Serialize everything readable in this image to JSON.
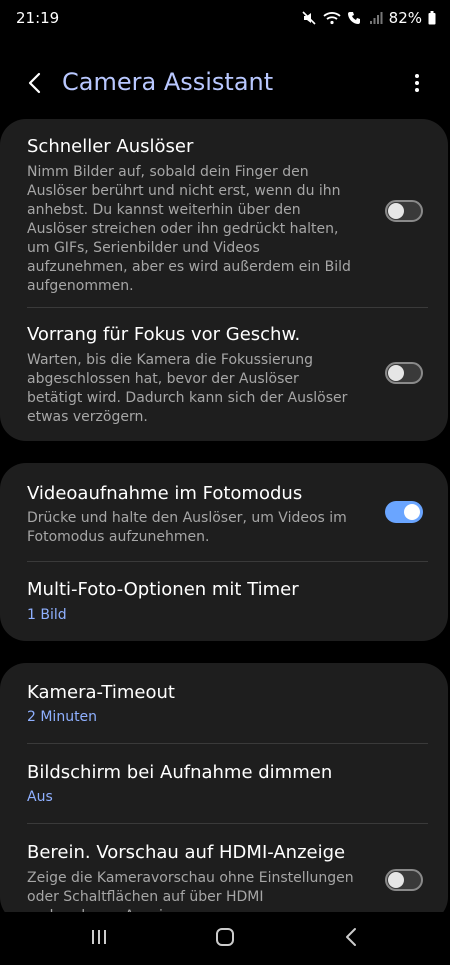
{
  "status": {
    "time": "21:19",
    "battery": "82%",
    "icons": [
      "mute-icon",
      "wifi-icon",
      "wifi-call-icon",
      "signal-icon",
      "battery-icon"
    ]
  },
  "appbar": {
    "title": "Camera Assistant",
    "back_icon": "chevron-left-icon",
    "more_icon": "more-vertical-icon"
  },
  "sections": [
    {
      "rows": [
        {
          "title": "Schneller Auslöser",
          "desc": "Nimm Bilder auf, sobald dein Finger den Auslöser berührt und nicht erst, wenn du ihn anhebst. Du kannst weiterhin über den Auslöser streichen oder ihn gedrückt halten, um GIFs, Serienbilder und Videos aufzunehmen, aber es wird außerdem ein Bild aufgenommen.",
          "toggle": false
        },
        {
          "title": "Vorrang für Fokus vor Geschw.",
          "desc": "Warten, bis die Kamera die Fokussierung abgeschlossen hat, bevor der Auslöser betätigt wird. Dadurch kann sich der Auslöser etwas verzögern.",
          "toggle": false
        }
      ]
    },
    {
      "rows": [
        {
          "title": "Videoaufnahme im Fotomodus",
          "desc": "Drücke und halte den Auslöser, um Videos im Fotomodus aufzunehmen.",
          "toggle": true
        },
        {
          "title": "Multi-Foto-Optionen mit Timer",
          "value": "1 Bild"
        }
      ]
    },
    {
      "rows": [
        {
          "title": "Kamera-Timeout",
          "value": "2 Minuten"
        },
        {
          "title": "Bildschirm bei Aufnahme dimmen",
          "value": "Aus"
        },
        {
          "title": "Berein. Vorschau auf HDMI-Anzeige",
          "desc": "Zeige die Kameravorschau ohne Einstellungen oder Schaltflächen auf über HDMI verbundenen Anzeigen an.",
          "toggle": false
        }
      ]
    }
  ],
  "navbar": {
    "icons": [
      "recent-apps-icon",
      "home-icon",
      "back-nav-icon"
    ]
  },
  "colors": {
    "background": "#000000",
    "card": "#1e1e1e",
    "accent": "#6aa5ff",
    "title_accent": "#b9c8ff",
    "value_text": "#8fb0ff"
  }
}
